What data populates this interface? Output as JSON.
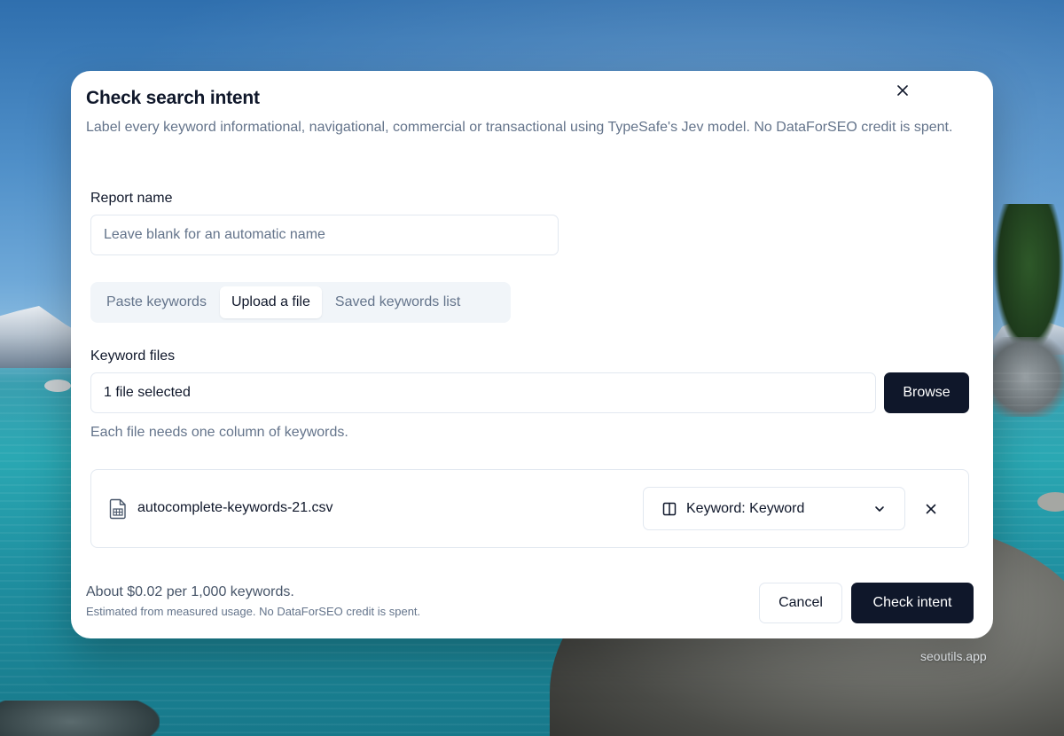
{
  "background": {
    "watermark": "seoutils.app"
  },
  "dialog": {
    "title": "Check search intent",
    "description": "Label every keyword informational, navigational, commercial or transactional using TypeSafe's Jev model. No DataForSEO credit is spent.",
    "close_icon": "close-icon",
    "report_name": {
      "label": "Report name",
      "value": "",
      "placeholder": "Leave blank for an automatic name"
    },
    "source_tabs": [
      {
        "label": "Paste keywords",
        "active": false
      },
      {
        "label": "Upload a file",
        "active": true
      },
      {
        "label": "Saved keywords list",
        "active": false
      }
    ],
    "keyword_files": {
      "label": "Keyword files",
      "status": "1 file selected",
      "browse_label": "Browse",
      "hint": "Each file needs one column of keywords."
    },
    "files": [
      {
        "icon": "spreadsheet-file-icon",
        "name": "autocomplete-keywords-21.csv",
        "column_select": "Keyword: Keyword",
        "column_icon": "column-icon",
        "chevron_icon": "chevron-down-icon",
        "remove_icon": "close-icon"
      }
    ],
    "footer": {
      "cost": "About $0.02 per 1,000 keywords.",
      "cost_note": "Estimated from measured usage. No DataForSEO credit is spent.",
      "cancel_label": "Cancel",
      "submit_label": "Check intent"
    }
  },
  "colors": {
    "primary": "#0f172a",
    "muted_text": "#64748b",
    "border": "#e2e8f0",
    "tab_bg": "#f1f5f9"
  }
}
